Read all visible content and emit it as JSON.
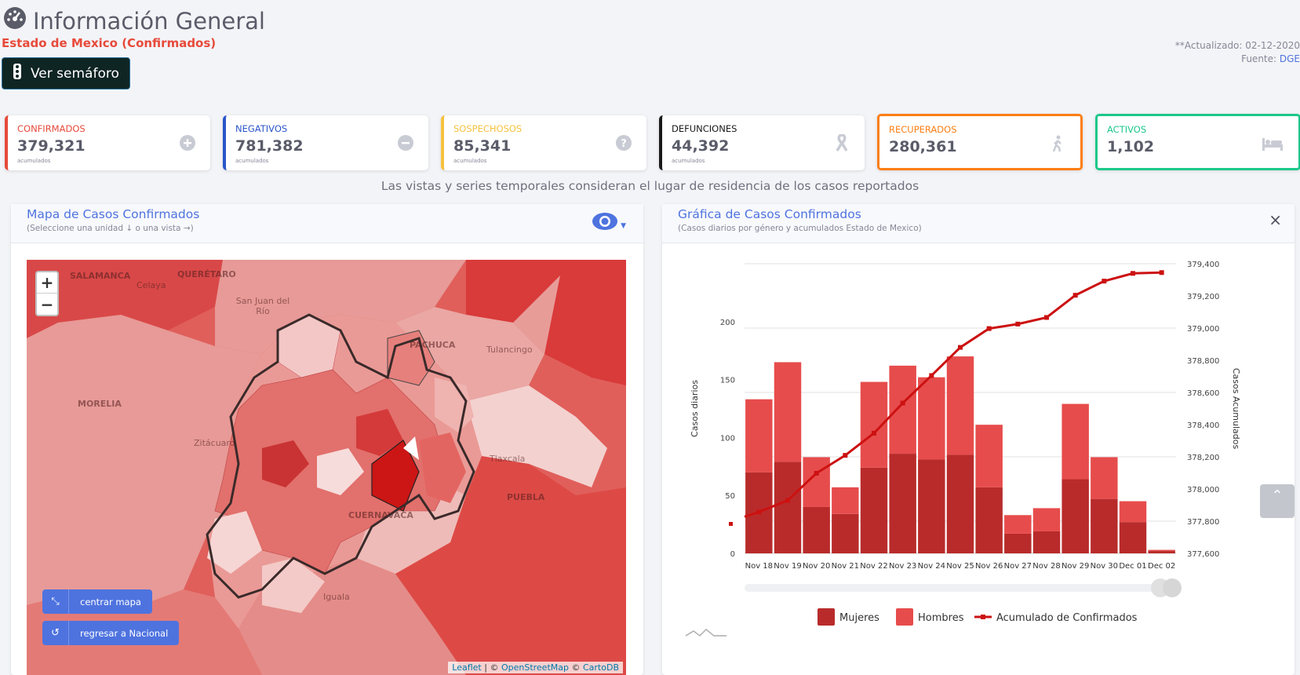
{
  "header": {
    "title": "Información General",
    "subtitle": "Estado de Mexico (Confirmados)",
    "semaforo_label": "Ver semáforo",
    "updated": "**Actualizado: 02-12-2020",
    "source_prefix": "Fuente: ",
    "source_link": "DGE"
  },
  "cards": [
    {
      "label": "CONFIRMADOS",
      "value": "379,321",
      "sub": "acumulados",
      "color": "#e74a3b",
      "icon": "plus-circle-icon"
    },
    {
      "label": "NEGATIVOS",
      "value": "781,382",
      "sub": "acumulados",
      "color": "#2b56c9",
      "icon": "minus-circle-icon"
    },
    {
      "label": "SOSPECHOSOS",
      "value": "85,341",
      "sub": "acumulados",
      "color": "#f6c23e",
      "icon": "question-circle-icon"
    },
    {
      "label": "DEFUNCIONES",
      "value": "44,392",
      "sub": "acumulados",
      "color": "#1a1a1a",
      "icon": "ribbon-icon"
    },
    {
      "label": "RECUPERADOS",
      "value": "280,361",
      "color": "#fd7e14",
      "icon": "walking-icon"
    },
    {
      "label": "ACTIVOS",
      "value": "1,102",
      "color": "#1cc88a",
      "icon": "bed-icon"
    }
  ],
  "note": "Las vistas y series temporales consideran el lugar de residencia de los casos reportados",
  "map_panel": {
    "title": "Mapa de Casos Confirmados",
    "subtitle": "(Seleccione una unidad ↓ o una vista →)",
    "zoom_in": "+",
    "zoom_out": "−",
    "btn_center": "centrar mapa",
    "btn_nacional": "regresar a Nacional",
    "attrib_leaflet": "Leaflet",
    "attrib_sep1": " | © ",
    "attrib_osm": "OpenStreetMap",
    "attrib_sep2": " © ",
    "attrib_carto": "CartoDB",
    "places": [
      "SALAMANCA",
      "QUERÉTARO",
      "Celaya",
      "San Juan del Río",
      "PACHUCA",
      "Tulancingo",
      "MORELIA",
      "Zitácuaro",
      "Tlaxcala",
      "PUEBLA",
      "CUERNAVACA",
      "Iguala"
    ]
  },
  "chart_panel": {
    "title": "Gráfica de Casos Confirmados",
    "subtitle": "(Casos diarios por género y acumulados Estado de Mexico)",
    "close": "×"
  },
  "chart_data": {
    "type": "bar",
    "categories": [
      "Nov 18",
      "Nov 19",
      "Nov 20",
      "Nov 21",
      "Nov 22",
      "Nov 23",
      "Nov 24",
      "Nov 25",
      "Nov 26",
      "Nov 27",
      "Nov 28",
      "Nov 29",
      "Nov 30",
      "Dec 01",
      "Dec 02"
    ],
    "series": [
      {
        "name": "Mujeres",
        "type": "bar",
        "stack": "s",
        "axis": "left",
        "color": "#b92b2b",
        "values": [
          70,
          79,
          40,
          34,
          74,
          86,
          81,
          85,
          57,
          17,
          19,
          64,
          47,
          27,
          2
        ]
      },
      {
        "name": "Hombres",
        "type": "bar",
        "stack": "s",
        "axis": "left",
        "color": "#e74c4c",
        "values": [
          63,
          86,
          43,
          23,
          74,
          76,
          71,
          85,
          54,
          16,
          20,
          65,
          36,
          18,
          1
        ]
      },
      {
        "name": "Acumulado de Confirmados",
        "type": "line",
        "axis": "right",
        "color": "#cc1111",
        "values": [
          377857,
          377929,
          378098,
          378209,
          378347,
          378534,
          378705,
          378880,
          378997,
          379025,
          379066,
          379204,
          379292,
          379340,
          379345
        ]
      }
    ],
    "ylabel": "Casos diarios",
    "y2label": "Casos Acumulados",
    "ylim": [
      0,
      250
    ],
    "yticks": [
      0,
      50,
      100,
      150,
      200
    ],
    "y2lim": [
      377600,
      379400
    ],
    "y2ticks": [
      377600,
      377800,
      378000,
      378200,
      378400,
      378600,
      378800,
      379000,
      379200,
      379400
    ],
    "legend": "bottom"
  }
}
